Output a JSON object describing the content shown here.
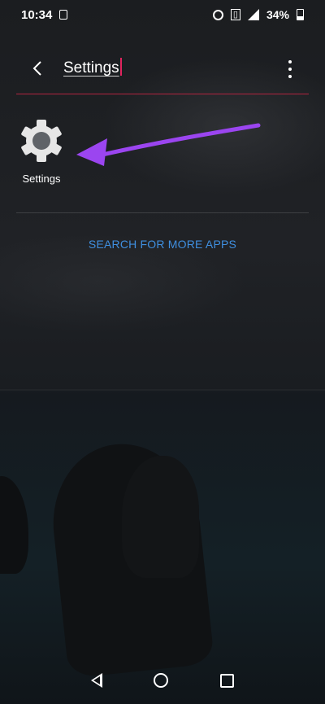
{
  "status_bar": {
    "time": "10:34",
    "battery_percent": "34%",
    "battery_level": 0.34,
    "icons": [
      "screen-icon",
      "alarm-icon",
      "vibrate-icon",
      "signal-icon",
      "battery-icon"
    ]
  },
  "search": {
    "query": "Settings",
    "back_icon": "back-arrow-icon",
    "menu_icon": "more-vert-icon",
    "accent_color": "#b0243f"
  },
  "results": [
    {
      "label": "Settings",
      "icon": "gear-icon"
    }
  ],
  "annotation": {
    "color": "#9b45f0",
    "type": "arrow"
  },
  "actions": {
    "search_more_label": "SEARCH FOR MORE APPS",
    "link_color": "#3f8fe0"
  },
  "nav_bar": {
    "icons": [
      "nav-back-icon",
      "nav-home-icon",
      "nav-recents-icon"
    ]
  }
}
